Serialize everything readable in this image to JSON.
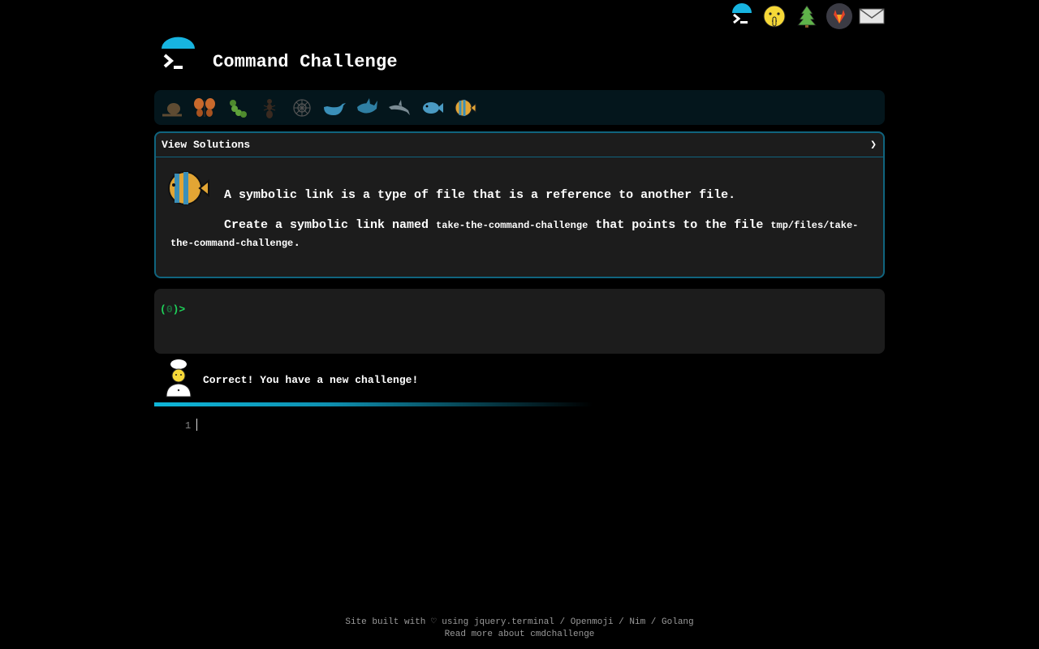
{
  "colors": {
    "accent": "#10647e",
    "cyan": "#0eb6d9",
    "prompt": "#1ed35a",
    "panel": "#1c1c1c"
  },
  "topbar": {
    "icons": [
      "terminal-logo-icon",
      "shushing-face-icon",
      "evergreen-tree-icon",
      "gitlab-icon",
      "envelope-icon"
    ]
  },
  "header": {
    "title": "Command Challenge"
  },
  "levels": [
    "snail-icon",
    "butterfly-icon",
    "caterpillar-icon",
    "ant-icon",
    "spider-web-icon",
    "whale-icon",
    "shark-icon",
    "dolphin-icon",
    "fish-icon",
    "tropical-fish-icon"
  ],
  "solutions": {
    "label": "View Solutions",
    "chevron": "❯"
  },
  "challenge": {
    "description": "A symbolic link is a type of file that is a reference to another file.",
    "task_prefix": "Create a symbolic link named ",
    "task_name": "take-the-command-challenge",
    "task_middle": " that points to the file ",
    "task_path": "tmp/files/take-the-command-challenge",
    "task_end": "."
  },
  "terminal": {
    "open": "(",
    "count": "0",
    "close": ")>"
  },
  "feedback": {
    "message": "Correct! You have a new challenge!"
  },
  "editor": {
    "line_number": "1"
  },
  "footer": {
    "built": "Site built with",
    "heart": "♡",
    "using": "using",
    "jquery": "jquery.terminal",
    "sep1": "/",
    "openmoji": "Openmoji",
    "sep2": "/",
    "nim": "Nim",
    "sep3": "/",
    "golang": "Golang",
    "read_more": "Read more about cmdchallenge"
  }
}
